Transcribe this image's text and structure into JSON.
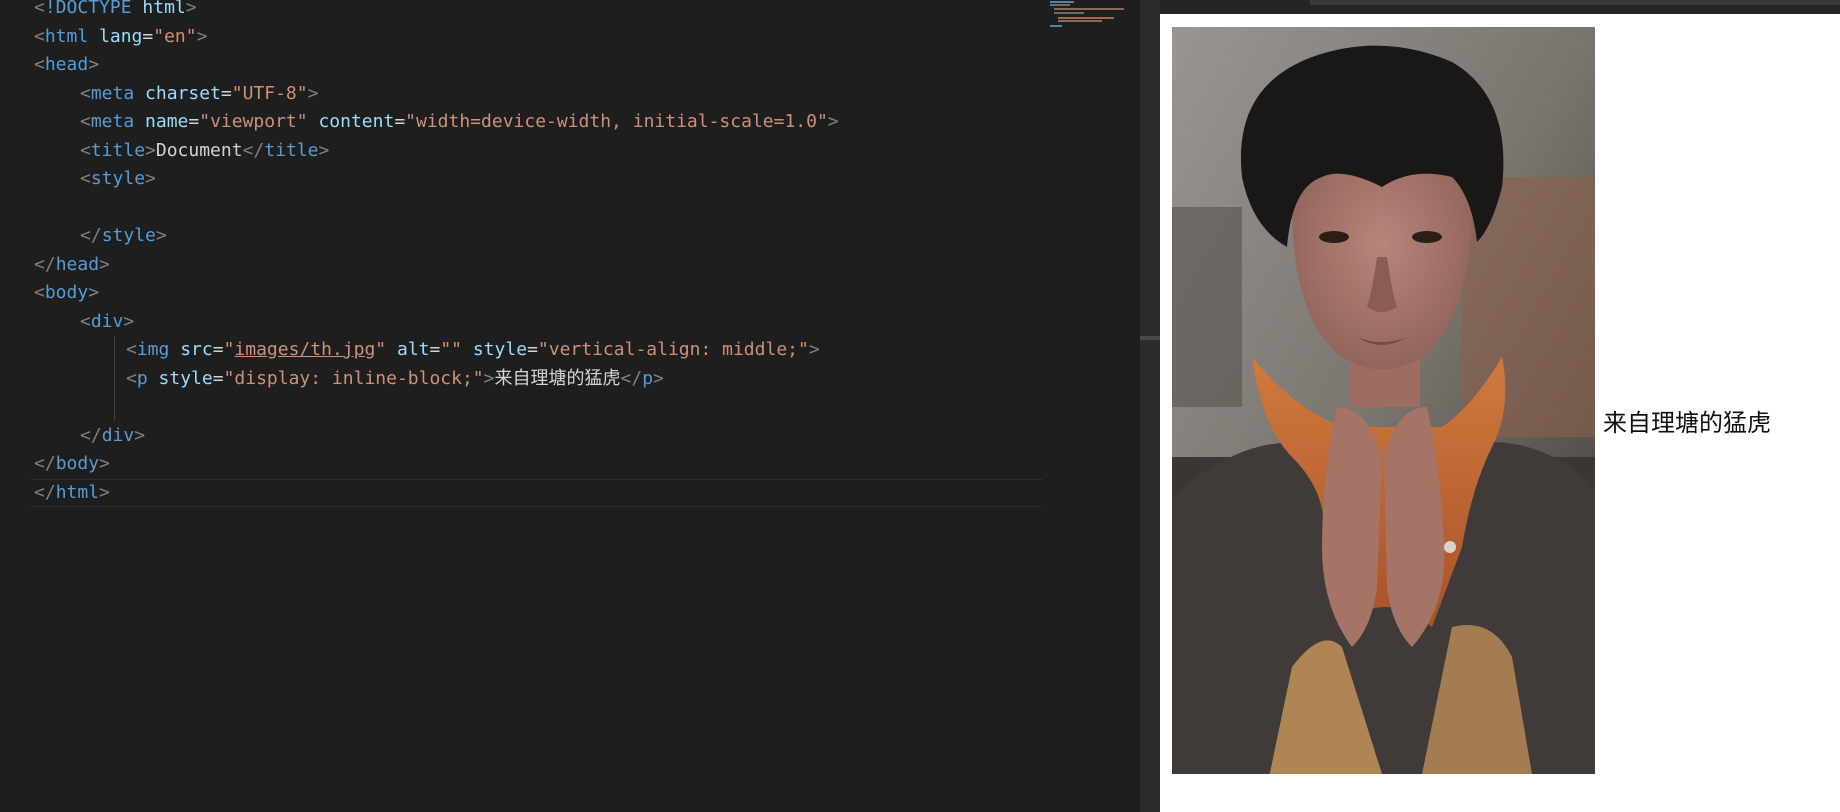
{
  "editor": {
    "lines": {
      "doctype": {
        "lt": "<",
        "bang": "!DOCTYPE",
        "sp": " ",
        "name": "html",
        "gt": ">"
      },
      "html_open": {
        "lt": "<",
        "tag": "html",
        "attr": " lang",
        "eq": "=",
        "val": "\"en\"",
        "gt": ">"
      },
      "head_open": {
        "lt": "<",
        "tag": "head",
        "gt": ">"
      },
      "meta_charset": {
        "lt": "<",
        "tag": "meta",
        "attr": " charset",
        "eq": "=",
        "val": "\"UTF-8\"",
        "gt": ">"
      },
      "meta_viewport": {
        "lt": "<",
        "tag": "meta",
        "attr1": " name",
        "eq1": "=",
        "val1": "\"viewport\"",
        "attr2": " content",
        "eq2": "=",
        "val2": "\"width=device-width, initial-scale=1.0\"",
        "gt": ">"
      },
      "title": {
        "lt": "<",
        "tag": "title",
        "gt": ">",
        "text": "Document",
        "close_lt": "</",
        "close_tag": "title",
        "close_gt": ">"
      },
      "style_open": {
        "lt": "<",
        "tag": "style",
        "gt": ">"
      },
      "style_close": {
        "lt": "</",
        "tag": "style",
        "gt": ">"
      },
      "head_close": {
        "lt": "</",
        "tag": "head",
        "gt": ">"
      },
      "body_open": {
        "lt": "<",
        "tag": "body",
        "gt": ">"
      },
      "div_open": {
        "lt": "<",
        "tag": "div",
        "gt": ">"
      },
      "img": {
        "lt": "<",
        "tag": "img",
        "attr1": " src",
        "eq1": "=",
        "q1": "\"",
        "link": "images/th.jpg",
        "q2": "\"",
        "attr2": " alt",
        "eq2": "=",
        "val2": "\"\"",
        "attr3": " style",
        "eq3": "=",
        "val3": "\"vertical-align: middle;\"",
        "gt": ">"
      },
      "p": {
        "lt": "<",
        "tag": "p",
        "attr": " style",
        "eq": "=",
        "val": "\"display: inline-block;\"",
        "gt": ">",
        "text": "来自理塘的猛虎",
        "close_lt": "</",
        "close_tag": "p",
        "close_gt": ">"
      },
      "div_close": {
        "lt": "</",
        "tag": "div",
        "gt": ">"
      },
      "body_close": {
        "lt": "</",
        "tag": "body",
        "gt": ">"
      },
      "html_close": {
        "lt": "</",
        "tag": "html",
        "gt": ">"
      }
    }
  },
  "preview": {
    "caption": "来自理塘的猛虎",
    "image": "photo"
  },
  "colors": {
    "editor_bg": "#1e1e1e",
    "tag": "#569cd6",
    "attr": "#9cdcfe",
    "string": "#ce9178",
    "punct": "#808080",
    "text": "#d4d4d4",
    "scarf": "#c0642e"
  }
}
